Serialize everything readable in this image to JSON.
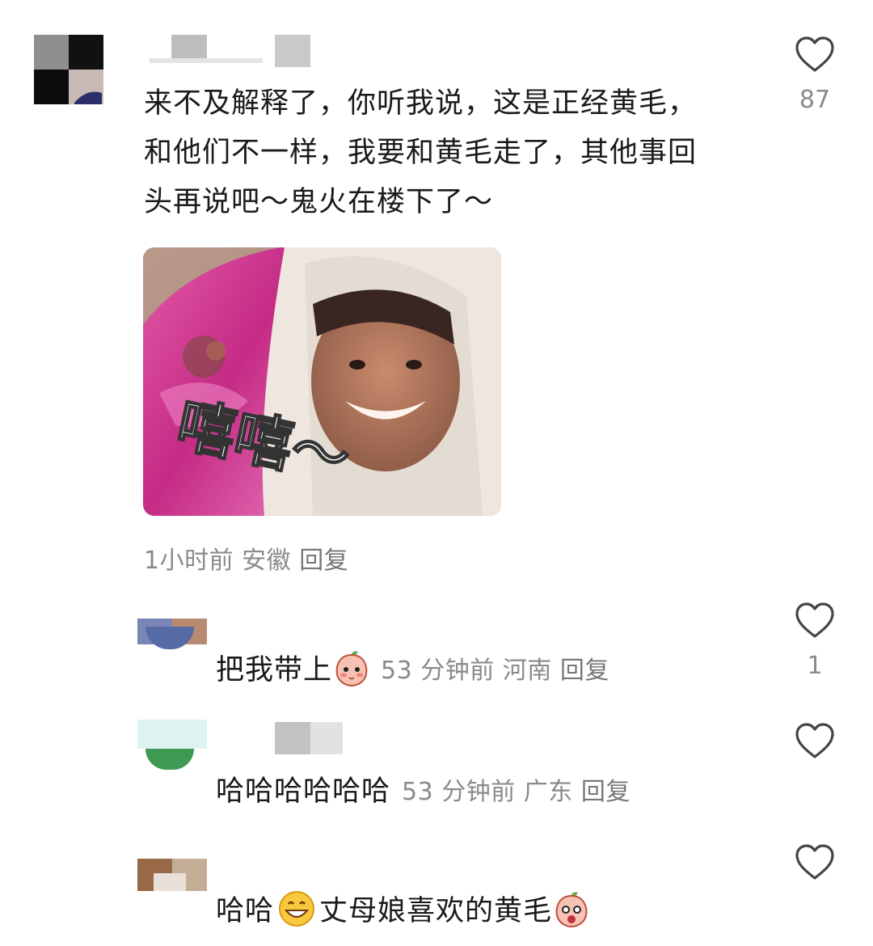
{
  "main_comment": {
    "text_lines": [
      "来不及解释了，你听我说，这是正经黄毛，",
      "和他们不一样，我要和黄毛走了，其他事回",
      "头再说吧～鬼火在楼下了～"
    ],
    "sticker_caption": "嘻嘻～",
    "time": "1小时前",
    "location": "安徽",
    "reply_label": "回复",
    "likes": "87"
  },
  "replies": [
    {
      "text": "把我带上",
      "emoji": "peach-blush-emoji",
      "time": "53 分钟前",
      "location": "河南",
      "reply_label": "回复",
      "likes": "1"
    },
    {
      "text": "哈哈哈哈哈哈",
      "emoji": "",
      "time": "53 分钟前",
      "location": "广东",
      "reply_label": "回复",
      "likes": ""
    },
    {
      "text_before": "哈哈",
      "emoji_middle": "grinning-face-emoji",
      "text_after": "丈母娘喜欢的黄毛",
      "emoji_end": "peach-surprised-emoji",
      "likes": ""
    }
  ],
  "colors": {
    "text": "#1a1a1a",
    "meta": "#8a8a8a",
    "heart_stroke": "#444444",
    "sticker_pink": "#d6338f"
  },
  "icons": [
    "heart-icon",
    "heart-icon",
    "heart-icon",
    "heart-icon"
  ]
}
